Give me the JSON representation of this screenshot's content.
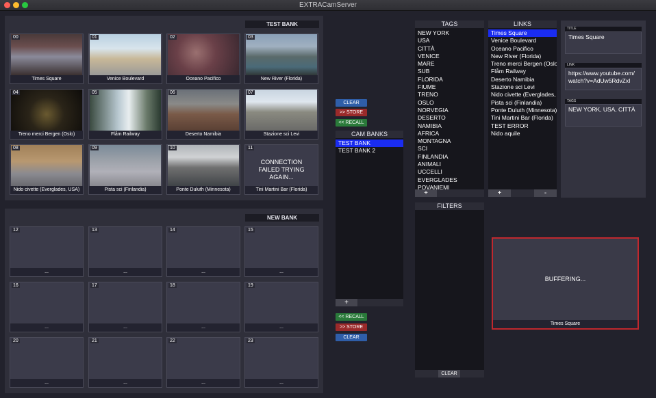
{
  "window": {
    "title": "EXTRACamServer"
  },
  "bank1": {
    "label": "TEST BANK",
    "cells": [
      {
        "num": "00",
        "caption": "Times Square"
      },
      {
        "num": "01",
        "caption": "Venice Boulevard"
      },
      {
        "num": "02",
        "caption": "Oceano Pacifico"
      },
      {
        "num": "03",
        "caption": "New River (Florida)"
      },
      {
        "num": "04",
        "caption": "Treno merci Bergen (Oslo)"
      },
      {
        "num": "05",
        "caption": "Flåm Railway"
      },
      {
        "num": "06",
        "caption": "Deserto Namibia"
      },
      {
        "num": "07",
        "caption": "Stazione sci Levi"
      },
      {
        "num": "08",
        "caption": "Nido civette (Everglades, USA)"
      },
      {
        "num": "09",
        "caption": "Pista sci (Finlandia)"
      },
      {
        "num": "10",
        "caption": "Ponte Duluth (Minnesota)"
      },
      {
        "num": "11",
        "caption": "Tini Martini Bar (Florida)",
        "error": "CONNECTION FAILED TRYING AGAIN..."
      }
    ]
  },
  "bank2": {
    "label": "NEW BANK",
    "cells": [
      {
        "num": "12",
        "caption": "..."
      },
      {
        "num": "13",
        "caption": "..."
      },
      {
        "num": "14",
        "caption": "..."
      },
      {
        "num": "15",
        "caption": "..."
      },
      {
        "num": "16",
        "caption": "..."
      },
      {
        "num": "17",
        "caption": "..."
      },
      {
        "num": "18",
        "caption": "..."
      },
      {
        "num": "19",
        "caption": "..."
      },
      {
        "num": "20",
        "caption": "..."
      },
      {
        "num": "21",
        "caption": "..."
      },
      {
        "num": "22",
        "caption": "..."
      },
      {
        "num": "23",
        "caption": "..."
      }
    ]
  },
  "controls": {
    "clear": "CLEAR",
    "store": ">> STORE",
    "recall": "<< RECALL",
    "clear2": "CLEAR",
    "store2": ">> STORE",
    "recall2": "<< RECALL",
    "add": "+"
  },
  "cambanks": {
    "header": "CAM BANKS",
    "items": [
      "TEST BANK",
      "TEST BANK 2"
    ],
    "selected": 0
  },
  "tags": {
    "header": "TAGS",
    "items": [
      "NEW YORK",
      "USA",
      "CITTÀ",
      "VENICE",
      "MARE",
      "SUB",
      "FLORIDA",
      "FIUME",
      "TRENO",
      "OSLO",
      "NORVEGIA",
      "DESERTO",
      "NAMIBIA",
      "AFRICA",
      "MONTAGNA",
      "SCI",
      "FINLANDIA",
      "ANIMALI",
      "UCCELLI",
      "EVERGLADES",
      "POVANIEMI"
    ],
    "add": "+"
  },
  "links": {
    "header": "LINKS",
    "items": [
      "Times Square",
      "Venice Boulevard",
      "Oceano Pacifico",
      "New River (Florida)",
      "Treno merci Bergen (Oslo",
      "Flåm Railway",
      "Deserto Namibia",
      "Stazione sci Levi",
      "Nido civette (Everglades,",
      "Pista sci (Finlandia)",
      "Ponte Duluth (Minnesota)",
      "Tini Martini Bar (Florida)",
      "TEST ERROR",
      "Nido aquile"
    ],
    "selected": 0,
    "add": "+",
    "remove": "-"
  },
  "details": {
    "title_label": "TITLE",
    "title_value": "Times Square",
    "link_label": "LINK",
    "link_value": "https://www.youtube.com/watch?v=AdUw5RdvZxI",
    "tags_label": "TAGS",
    "tags_value": "NEW YORK, USA, CITTÀ"
  },
  "filters": {
    "header": "FILTERS",
    "clear": "CLEAR"
  },
  "preview": {
    "status": "BUFFERING...",
    "caption": "Times Square",
    "border": "#c0282e"
  },
  "colors": {
    "selection": "#1a2cf0",
    "clear": "#2f5ea8",
    "store": "#9a2a2a",
    "recall": "#2a7a3a"
  },
  "icons": [
    "close-dot",
    "minimize-dot",
    "zoom-dot"
  ]
}
